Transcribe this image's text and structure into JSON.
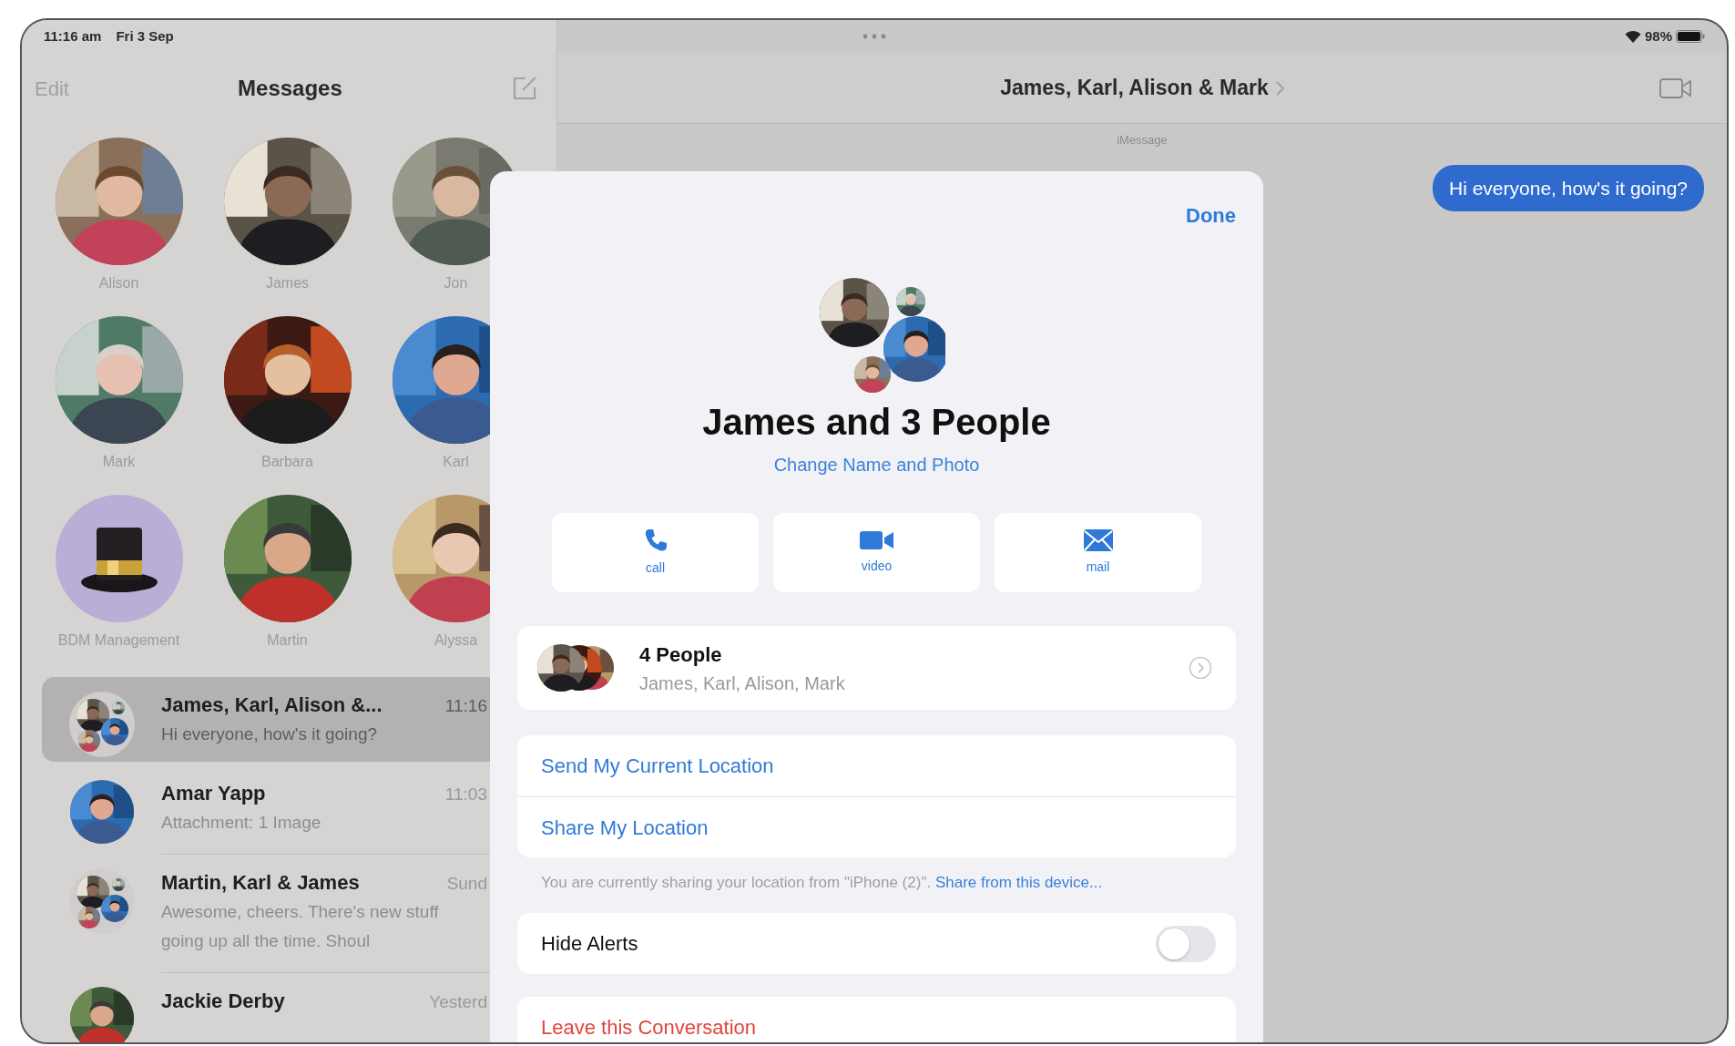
{
  "status_bar": {
    "time": "11:16 am",
    "date": "Fri 3 Sep",
    "battery": "98%"
  },
  "sidebar": {
    "edit": "Edit",
    "title": "Messages",
    "pinned": [
      {
        "name": "Alison"
      },
      {
        "name": "James"
      },
      {
        "name": "Jon"
      },
      {
        "name": "Mark"
      },
      {
        "name": "Barbara"
      },
      {
        "name": "Karl"
      },
      {
        "name": "BDM Management",
        "kind": "emoji"
      },
      {
        "name": "Martin"
      },
      {
        "name": "Alyssa"
      }
    ],
    "conversations": [
      {
        "name": "James, Karl, Alison &...",
        "time": "11:16",
        "preview": "Hi everyone, how's it going?",
        "kind": "group",
        "selected": true
      },
      {
        "name": "Amar Yapp",
        "time": "11:03",
        "preview": "Attachment: 1 Image",
        "kind": "single",
        "selected": false
      },
      {
        "name": "Martin, Karl & James",
        "time": "Sund",
        "preview": "Awesome, cheers. There's new stuff going up all the time. Shoul",
        "kind": "group",
        "selected": false
      },
      {
        "name": "Jackie Derby",
        "time": "Yesterd",
        "kind": "single",
        "selected": false
      }
    ]
  },
  "conversation": {
    "title": "James, Karl, Alison & Mark",
    "service": "iMessage",
    "messages": [
      {
        "text": "Hi everyone, how's it going?",
        "outgoing": true
      }
    ]
  },
  "details": {
    "done": "Done",
    "name": "James and 3 People",
    "change": "Change Name and Photo",
    "actions": [
      {
        "label": "call",
        "kind": "call"
      },
      {
        "label": "video",
        "kind": "video"
      },
      {
        "label": "mail",
        "kind": "mail"
      }
    ],
    "people": {
      "title": "4 People",
      "names": "James, Karl, Alison, Mark"
    },
    "location_actions": [
      "Send My Current Location",
      "Share My Location"
    ],
    "location_note": "You are currently sharing your location from \"iPhone (2)\".",
    "location_link": "Share from this device...",
    "hide_alerts": {
      "label": "Hide Alerts",
      "on": false
    },
    "leave": "Leave this Conversation"
  }
}
